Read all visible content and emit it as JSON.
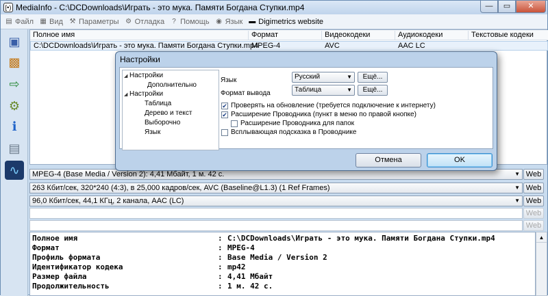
{
  "window": {
    "title": "MediaInfo - C:\\DCDownloads\\Играть - это мука. Памяти Богдана Ступки.mp4",
    "app_icon": "[•)",
    "minimize_glyph": "—",
    "maximize_glyph": "▭",
    "close_glyph": "✕"
  },
  "menu": [
    {
      "label": "Файл",
      "icon": "file-icon",
      "glyph": "▤"
    },
    {
      "label": "Вид",
      "icon": "view-icon",
      "glyph": "▦"
    },
    {
      "label": "Параметры",
      "icon": "options-icon",
      "glyph": "⚒"
    },
    {
      "label": "Отладка",
      "icon": "debug-icon",
      "glyph": "⚙"
    },
    {
      "label": "Помощь",
      "icon": "help-icon",
      "glyph": "?"
    },
    {
      "label": "Язык",
      "icon": "globe-icon",
      "glyph": "◉"
    },
    {
      "label": "Digimetrics website",
      "icon": "digimetrics-icon",
      "glyph": "▬"
    }
  ],
  "toolbar_icons": [
    {
      "name": "open-file-icon",
      "glyph": "▣",
      "color": "#3a5fa8"
    },
    {
      "name": "open-folder-icon",
      "glyph": "▩",
      "color": "#c47a1b"
    },
    {
      "name": "export-icon",
      "glyph": "⇨",
      "color": "#2a8a3a"
    },
    {
      "name": "preferences-icon",
      "glyph": "⚙",
      "color": "#6a8a2a"
    },
    {
      "name": "about-icon",
      "glyph": "ℹ",
      "color": "#1e62c8"
    },
    {
      "name": "knowledge-base-icon",
      "glyph": "▤",
      "color": "#6b7a8a"
    },
    {
      "name": "digimetrics-icon",
      "glyph": "∿",
      "color": "#1c3a6a"
    }
  ],
  "filelist": {
    "headers": [
      "Полное имя",
      "Формат",
      "Видеокодеки",
      "Аудиокодеки",
      "Текстовые кодеки"
    ],
    "row": [
      "C:\\DCDownloads\\Играть - это мука. Памяти Богдана Ступки.mp4",
      "MPEG-4",
      "AVC",
      "AAC LC",
      ""
    ]
  },
  "dialog": {
    "title": "Настройки",
    "tree": {
      "root1": "Настройки",
      "root1_child": "Дополнительно",
      "root2": "Настройки",
      "root2_children": [
        "Таблица",
        "Дерево и текст",
        "Выборочно",
        "Язык"
      ]
    },
    "language_label": "Язык",
    "language_value": "Русский",
    "output_label": "Формат вывода",
    "output_value": "Таблица",
    "more_label": "Ещё...",
    "checkboxes": [
      {
        "label": "Проверять на обновление (требуется подключение к интернету)",
        "checked": true
      },
      {
        "label": "Расширение Проводника (пункт в меню по правой кнопке)",
        "checked": true
      },
      {
        "label": "Расширение Проводника для папок",
        "checked": false
      },
      {
        "label": "Всплывающая подсказка в Проводнике",
        "checked": false
      }
    ],
    "cancel_label": "Отмена",
    "ok_label": "OK"
  },
  "streams": [
    {
      "text": "MPEG-4 (Base Media / Version 2): 4,41 Мбайт, 1 м. 42 с.",
      "web": "Web",
      "enabled": true
    },
    {
      "text": "263 Кбит/сек, 320*240 (4:3), в 25,000 кадров/сек, AVC (Baseline@L1.3) (1 Ref Frames)",
      "web": "Web",
      "enabled": true
    },
    {
      "text": "96,0 Кбит/сек, 44,1 КГц, 2 канала, AAC (LC)",
      "web": "Web",
      "enabled": true
    },
    {
      "text": "",
      "web": "Web",
      "enabled": false
    },
    {
      "text": "",
      "web": "Web",
      "enabled": false
    }
  ],
  "info": [
    {
      "key": "Полное имя",
      "value": "C:\\DCDownloads\\Играть - это мука. Памяти Богдана Ступки.mp4"
    },
    {
      "key": "Формат",
      "value": "MPEG-4"
    },
    {
      "key": "Профиль формата",
      "value": "Base Media / Version 2"
    },
    {
      "key": "Идентификатор кодека",
      "value": "mp42"
    },
    {
      "key": "Размер файла",
      "value": "4,41 Мбайт"
    },
    {
      "key": "Продолжительность",
      "value": "1 м. 42 с."
    }
  ],
  "info_separator": ":",
  "dropdown_glyph": "▼",
  "scroll_up_glyph": "▲",
  "tree_open_glyph": "◢",
  "checkmark_glyph": "✔"
}
